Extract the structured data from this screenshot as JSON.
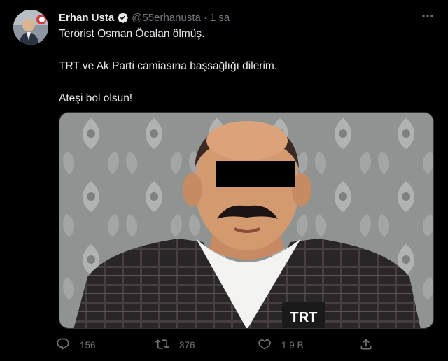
{
  "author": {
    "name": "Erhan Usta",
    "handle": "@55erhanusta",
    "separator": "·",
    "time": "1 sa"
  },
  "tweet": {
    "lines": [
      "Terörist Osman Öcalan ölmüş.",
      "TRT ve Ak Parti camiasına başsağlığı dilerim.",
      "Ateşi bol olsun!"
    ]
  },
  "media": {
    "watermark": "TRT"
  },
  "actions": {
    "reply_count": "156",
    "retweet_count": "376",
    "like_count": "1,9 B"
  },
  "colors": {
    "background": "#000000",
    "text": "#e7e9ea",
    "muted": "#71767b",
    "verified": "#1d9bf0"
  },
  "icons": {
    "verified": "verified-badge-icon",
    "more": "more-dots-icon",
    "reply": "reply-icon",
    "retweet": "retweet-icon",
    "like": "like-icon",
    "share": "share-icon"
  }
}
